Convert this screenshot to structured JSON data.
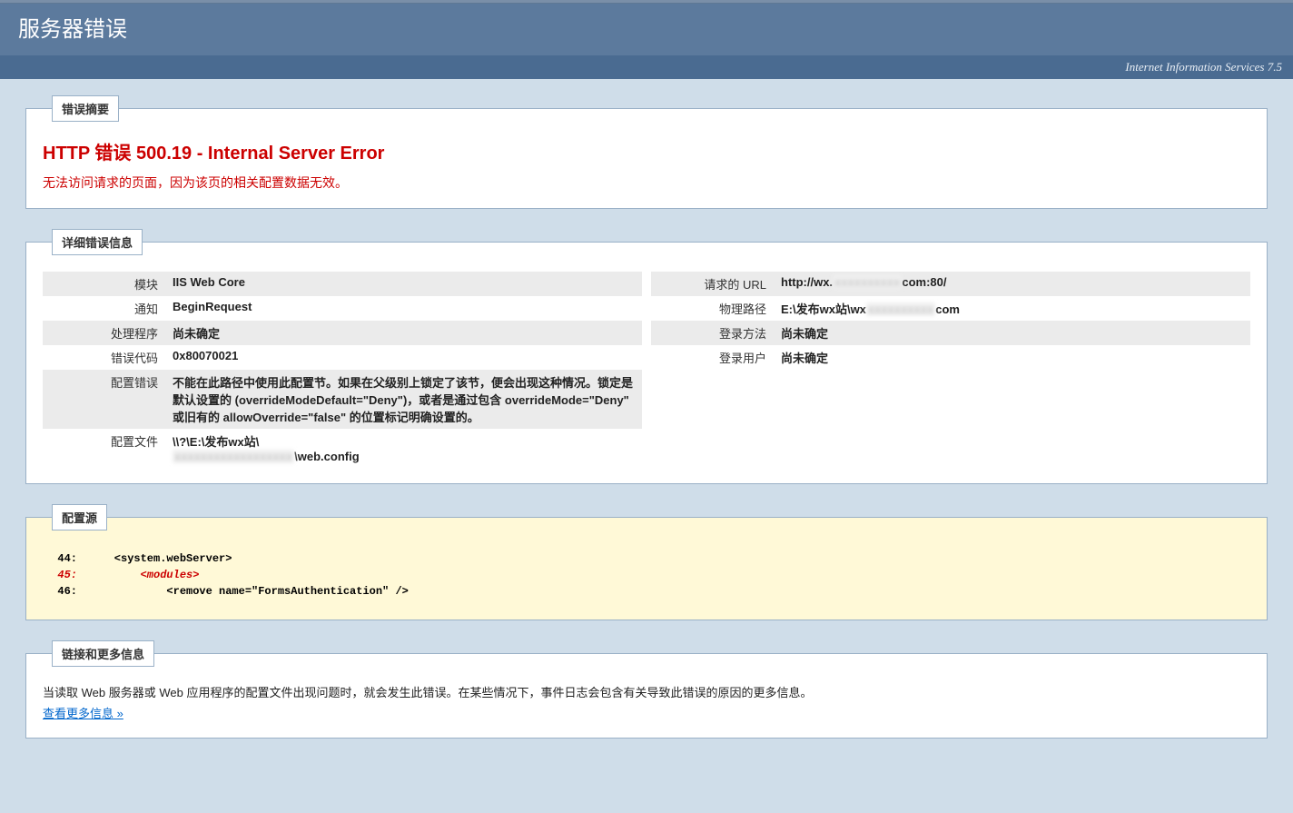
{
  "header": {
    "title": "服务器错误",
    "subtitle": "Internet Information Services 7.5"
  },
  "summary": {
    "legend": "错误摘要",
    "title": "HTTP 错误 500.19 - Internal Server Error",
    "subtitle": "无法访问请求的页面，因为该页的相关配置数据无效。"
  },
  "details": {
    "legend": "详细错误信息",
    "left": {
      "module_label": "模块",
      "module_value": "IIS Web Core",
      "notification_label": "通知",
      "notification_value": "BeginRequest",
      "handler_label": "处理程序",
      "handler_value": "尚未确定",
      "errorcode_label": "错误代码",
      "errorcode_value": "0x80070021",
      "configerr_label": "配置错误",
      "configerr_value": "不能在此路径中使用此配置节。如果在父级别上锁定了该节，便会出现这种情况。锁定是默认设置的 (overrideModeDefault=\"Deny\")，或者是通过包含 overrideMode=\"Deny\" 或旧有的 allowOverride=\"false\" 的位置标记明确设置的。",
      "configfile_label": "配置文件",
      "configfile_prefix": "\\\\?\\E:\\发布wx站\\",
      "configfile_suffix": "\\web.config"
    },
    "right": {
      "url_label": "请求的 URL",
      "url_prefix": "http://wx.",
      "url_suffix": "com:80/",
      "physpath_label": "物理路径",
      "physpath_prefix": "E:\\发布wx站\\wx",
      "physpath_suffix": "com",
      "logon_label": "登录方法",
      "logon_value": "尚未确定",
      "user_label": "登录用户",
      "user_value": "尚未确定"
    }
  },
  "config_source": {
    "legend": "配置源",
    "lines": {
      "n44": "44:",
      "c44": "    <system.webServer>",
      "n45": "45:",
      "c45": "        <modules>",
      "n46": "46:",
      "c46": "            <remove name=\"FormsAuthentication\" />"
    }
  },
  "more_info": {
    "legend": "链接和更多信息",
    "text": "当读取 Web 服务器或 Web 应用程序的配置文件出现问题时，就会发生此错误。在某些情况下，事件日志会包含有关导致此错误的原因的更多信息。",
    "link_text": "查看更多信息 »"
  }
}
